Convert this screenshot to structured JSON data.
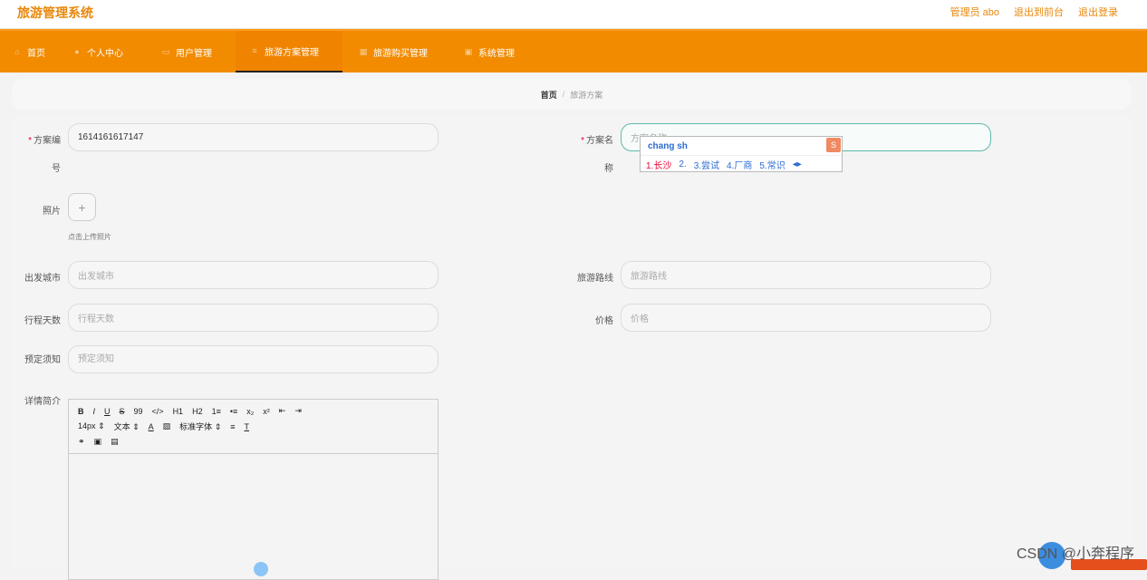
{
  "header": {
    "title": "旅游管理系统",
    "links": [
      "管理员 abo",
      "退出到前台",
      "退出登录"
    ]
  },
  "nav": [
    {
      "icon": "home-icon",
      "label": "首页"
    },
    {
      "icon": "user-icon",
      "label": "个人中心"
    },
    {
      "icon": "user-manage-icon",
      "label": "用户管理"
    },
    {
      "icon": "plan-icon",
      "label": "旅游方案管理"
    },
    {
      "icon": "purchase-icon",
      "label": "旅游购买管理"
    },
    {
      "icon": "system-icon",
      "label": "系统管理"
    }
  ],
  "breadcrumb": {
    "home": "首页",
    "current": "旅游方案"
  },
  "form": {
    "plan_no_label_1": "方案编",
    "plan_no_label_2": "号",
    "plan_no_value": "1614161617147",
    "plan_name_label_1": "方案名",
    "plan_name_label_2": "称",
    "plan_name_placeholder": "方案名称",
    "photo_label": "照片",
    "upload_tip": "点击上传照片",
    "city_label": "出发城市",
    "city_placeholder": "出发城市",
    "route_label": "旅游路线",
    "route_placeholder": "旅游路线",
    "days_label": "行程天数",
    "days_placeholder": "行程天数",
    "price_label": "价格",
    "price_placeholder": "价格",
    "notice_label": "预定须知",
    "notice_placeholder": "预定须知",
    "detail_label": "详情简介"
  },
  "ime": {
    "pinyin": "chang sh",
    "candidates": [
      "1.长沙",
      "2.",
      "3.尝试",
      "4.厂商",
      "5.常识"
    ]
  },
  "editor": {
    "row1": [
      "B",
      "I",
      "U",
      "S",
      "99",
      "</>",
      "H1",
      "H2",
      "1≡",
      "•≡",
      "x₂",
      "x²",
      "⇤",
      "⇥"
    ],
    "fontsize": "14px",
    "texttype": "文本",
    "fontface": "标准字体"
  },
  "watermark": "CSDN @小奔程序"
}
